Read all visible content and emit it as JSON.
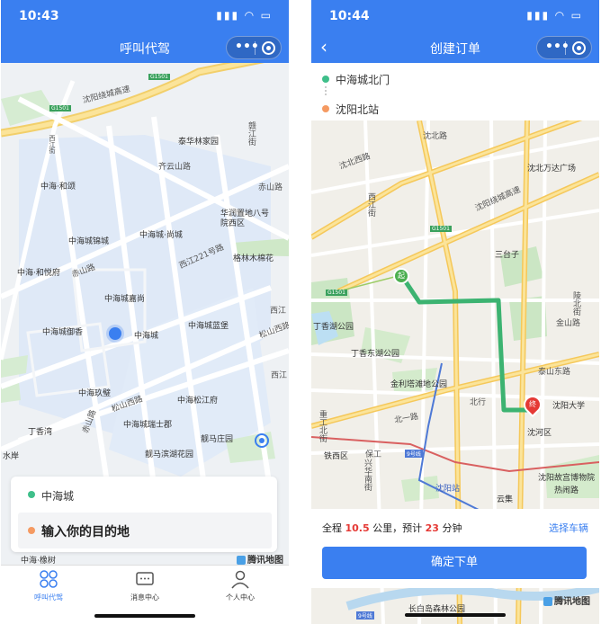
{
  "screen1": {
    "status": {
      "time": "10:43"
    },
    "nav": {
      "title": "呼叫代驾"
    },
    "map": {
      "labels": [
        "沈阳绕城高速",
        "G1501",
        "G1501",
        "西江街",
        "泰华林家园",
        "赣江街",
        "中海·和颂",
        "齐云山路",
        "赤山路",
        "中海城锦城",
        "中海城·尚城",
        "华润置地八号院西区",
        "中海·和悦府",
        "赤山路",
        "中海城嘉尚",
        "西江221号路",
        "格林木棉花",
        "中海城御香",
        "中海城",
        "中海城蓝堡",
        "西江",
        "松山西路",
        "中海玖璧",
        "中海松江府",
        "松山西路",
        "丁香湾",
        "中海城瑞士郡",
        "靓马庄园",
        "靓马滨湖花园",
        "赤山路",
        "水岸",
        "西江",
        "中海·橡树"
      ],
      "watermark": "腾讯地图"
    },
    "card": {
      "origin": "中海城",
      "destination_placeholder": "输入你的目的地"
    },
    "tabs": [
      {
        "label": "呼叫代驾",
        "icon": "grid-icon",
        "active": true
      },
      {
        "label": "消息中心",
        "icon": "message-icon",
        "active": false
      },
      {
        "label": "个人中心",
        "icon": "person-icon",
        "active": false
      }
    ]
  },
  "screen2": {
    "status": {
      "time": "10:44"
    },
    "nav": {
      "title": "创建订单"
    },
    "route": {
      "origin": "中海城北门",
      "destination": "沈阳北站"
    },
    "map": {
      "labels": [
        "沈北路",
        "沈北西路",
        "沈北万达广场",
        "西江街",
        "沈阳绕城高速",
        "G1501",
        "三台子",
        "G1501",
        "陵北街",
        "丁香湖公园",
        "金山路",
        "丁香东湖公园",
        "泰山东路",
        "金利塔滩地公园",
        "北行",
        "沈阳大学",
        "北一路",
        "沈河区",
        "重工北街",
        "铁西区",
        "保工",
        "9号线",
        "沈阳站",
        "沈阳故宫博物院",
        "云集",
        "热闹路",
        "兴华南街",
        "长白岛森林公园",
        "9号线"
      ],
      "start_marker": "起",
      "end_marker": "终",
      "watermark": "腾讯地图"
    },
    "summary": {
      "prefix": "全程",
      "distance": "10.5",
      "unit_km": "公里，预计",
      "minutes": "23",
      "unit_min": "分钟",
      "select_vehicle": "选择车辆"
    },
    "confirm_label": "确定下单"
  },
  "colors": {
    "brand": "#3a7ff0",
    "route": "#3cb371",
    "accent_red": "#e53935",
    "origin_dot": "#3fbf8a",
    "dest_dot": "#f59a62"
  }
}
